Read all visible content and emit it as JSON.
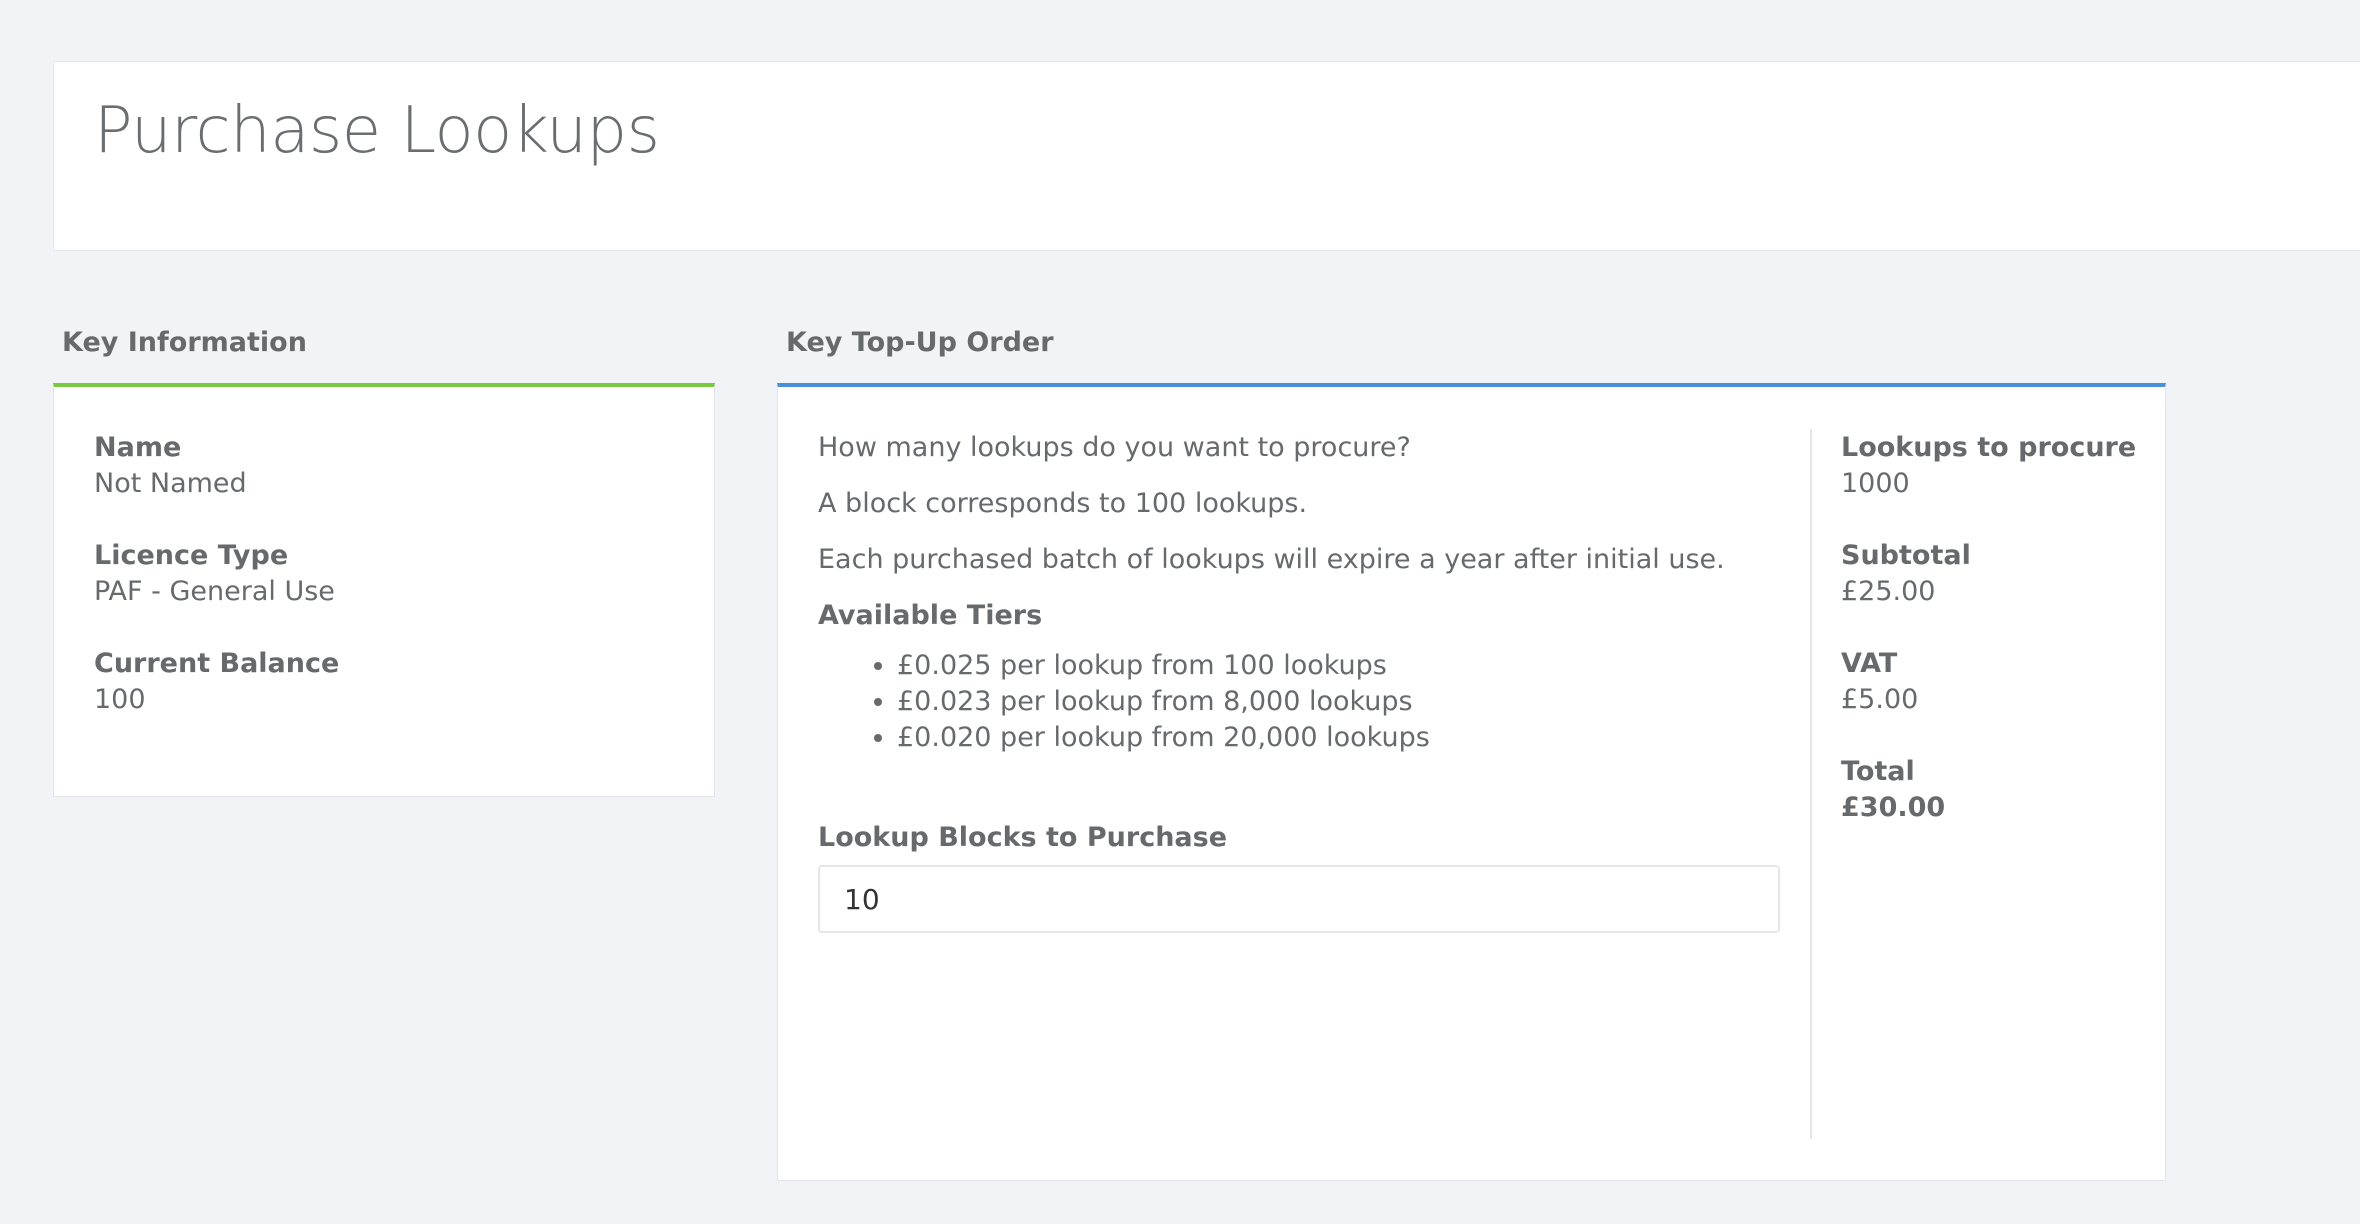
{
  "page": {
    "title": "Purchase Lookups"
  },
  "key_information": {
    "heading": "Key Information",
    "fields": [
      {
        "label": "Name",
        "value": "Not Named"
      },
      {
        "label": "Licence Type",
        "value": "PAF - General Use"
      },
      {
        "label": "Current Balance",
        "value": "100"
      }
    ],
    "accent_color": "#7ac943"
  },
  "top_up_order": {
    "heading": "Key Top-Up Order",
    "accent_color": "#4a90d9",
    "intro": [
      "How many lookups do you want to procure?",
      "A block corresponds to 100 lookups.",
      "Each purchased batch of lookups will expire a year after initial use."
    ],
    "tiers_title": "Available Tiers",
    "tiers": [
      "£0.025 per lookup from 100 lookups",
      "£0.023 per lookup from 8,000 lookups",
      "£0.020 per lookup from 20,000 lookups"
    ],
    "blocks_label": "Lookup Blocks to Purchase",
    "blocks_value": "10",
    "summary": [
      {
        "label": "Lookups to procure",
        "value": "1000"
      },
      {
        "label": "Subtotal",
        "value": "£25.00"
      },
      {
        "label": "VAT",
        "value": "£5.00"
      },
      {
        "label": "Total",
        "value": "£30.00"
      }
    ]
  }
}
